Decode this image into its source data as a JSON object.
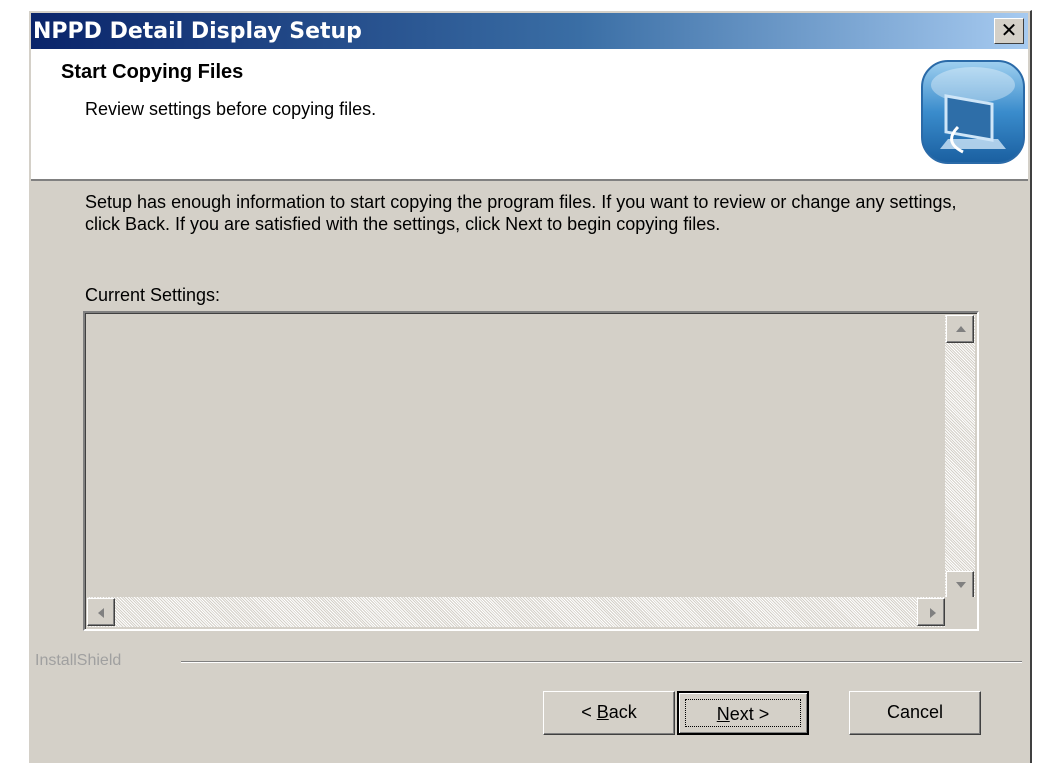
{
  "window": {
    "title": "NPPD Detail Display Setup",
    "close_glyph": "✕"
  },
  "header": {
    "title": "Start Copying Files",
    "subtitle": "Review settings before copying files.",
    "icon": "setup-computer-icon"
  },
  "body": {
    "description": "Setup has enough information to start copying the program files.  If you want to review or change any settings, click Back.  If you are satisfied with the settings, click Next to begin copying files.",
    "settings_label": "Current Settings:",
    "settings_value": ""
  },
  "footer": {
    "brand": "InstallShield",
    "back_prefix": "< ",
    "back_key": "B",
    "back_rest": "ack",
    "next_key": "N",
    "next_rest": "ext >",
    "cancel_label": "Cancel"
  },
  "colors": {
    "dialog_bg": "#d4d0c8",
    "title_start": "#0a246a",
    "title_end": "#a6caf0"
  }
}
